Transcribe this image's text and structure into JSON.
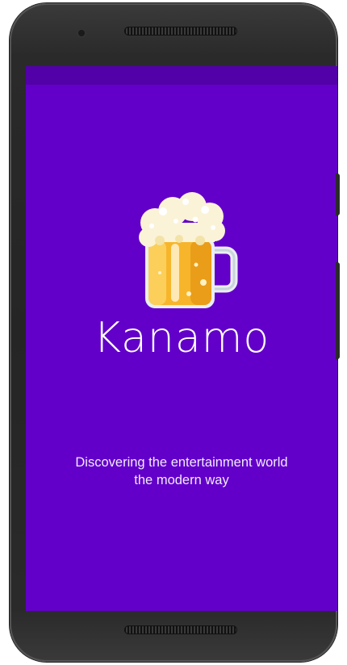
{
  "app": {
    "name": "Kanamo",
    "tagline_line1": "Discovering the entertainment world",
    "tagline_line2": "the modern way"
  },
  "logo": {
    "icon": "beer-mug-icon"
  },
  "colors": {
    "screen_background": "#6200c9",
    "status_bar": "#5200a8",
    "text": "#ffffff",
    "beer": "#f7b52c",
    "foam": "#fbf3d8"
  }
}
